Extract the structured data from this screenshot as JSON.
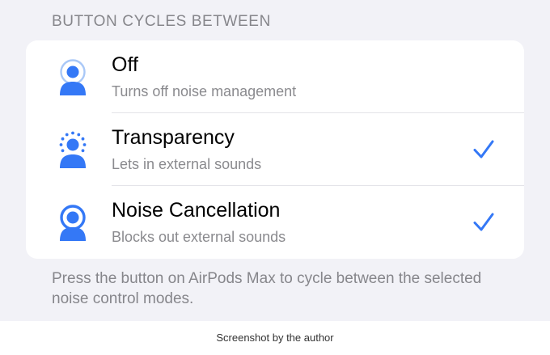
{
  "section_header": "BUTTON CYCLES BETWEEN",
  "rows": [
    {
      "title": "Off",
      "subtitle": "Turns off noise management",
      "icon": "person-off-icon",
      "checked": false
    },
    {
      "title": "Transparency",
      "subtitle": "Lets in external sounds",
      "icon": "person-transparency-icon",
      "checked": true
    },
    {
      "title": "Noise Cancellation",
      "subtitle": "Blocks out external sounds",
      "icon": "person-noise-cancellation-icon",
      "checked": true
    }
  ],
  "footer": "Press the button on AirPods Max to cycle between the selected noise control modes.",
  "caption": "Screenshot by the author",
  "colors": {
    "accent": "#3478f6",
    "background": "#f2f2f7",
    "card": "#ffffff",
    "secondary_text": "#86868b"
  }
}
